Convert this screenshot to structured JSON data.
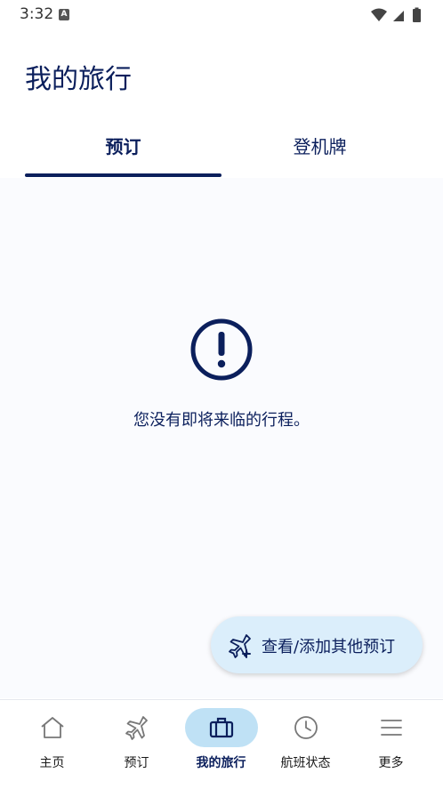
{
  "status_bar": {
    "time": "3:32",
    "notification_letter": "A"
  },
  "header": {
    "title": "我的旅行"
  },
  "tabs": [
    {
      "label": "预订",
      "selected": true
    },
    {
      "label": "登机牌",
      "selected": false
    }
  ],
  "empty_state": {
    "icon": "alert-circle-icon",
    "message": "您没有即将来临的行程。"
  },
  "fab": {
    "icon": "plane-add-icon",
    "label": "查看/添加其他预订"
  },
  "bottom_nav": {
    "items": [
      {
        "label": "主页",
        "icon": "home-icon",
        "active": false
      },
      {
        "label": "预订",
        "icon": "airplane-icon",
        "active": false
      },
      {
        "label": "我的旅行",
        "icon": "suitcase-icon",
        "active": true
      },
      {
        "label": "航班状态",
        "icon": "clock-icon",
        "active": false
      },
      {
        "label": "更多",
        "icon": "menu-icon",
        "active": false
      }
    ]
  },
  "colors": {
    "primary": "#0b1f5c",
    "active_pill": "#bfe1f5",
    "fab_bg": "#dbeefb",
    "content_bg": "#fafbfe"
  }
}
